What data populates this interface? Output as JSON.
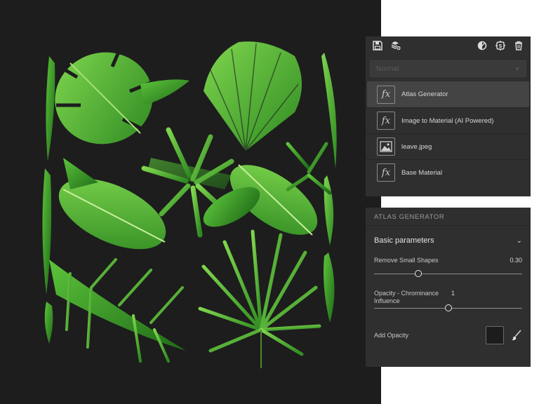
{
  "toolbar": {
    "icons": [
      "save-icon",
      "add-layers-icon",
      "mask-icon",
      "substance-filter-icon",
      "trash-icon"
    ]
  },
  "layers": {
    "blend_mode": "Normal",
    "items": [
      {
        "name": "Atlas Generator",
        "icon": "fx-icon",
        "selected": true
      },
      {
        "name": "Image to Material (AI Powered)",
        "icon": "fx-icon",
        "selected": false
      },
      {
        "name": "leave.jpeg",
        "icon": "image-icon",
        "selected": false
      },
      {
        "name": "Base Material",
        "icon": "fx-icon",
        "selected": false
      }
    ]
  },
  "properties": {
    "title": "ATLAS GENERATOR",
    "section": "Basic parameters",
    "params": [
      {
        "label": "Remove Small Shapes",
        "value": "0.30",
        "fraction": 0.3
      },
      {
        "label": "Opacity - Chrominance Influence",
        "value": "1",
        "fraction": 0.5
      }
    ],
    "add_opacity_label": "Add Opacity"
  },
  "colors": {
    "canvas_bg": "#1d1d1d",
    "panel_bg": "#2f2f2f",
    "leaf_green": "#4caf35"
  }
}
